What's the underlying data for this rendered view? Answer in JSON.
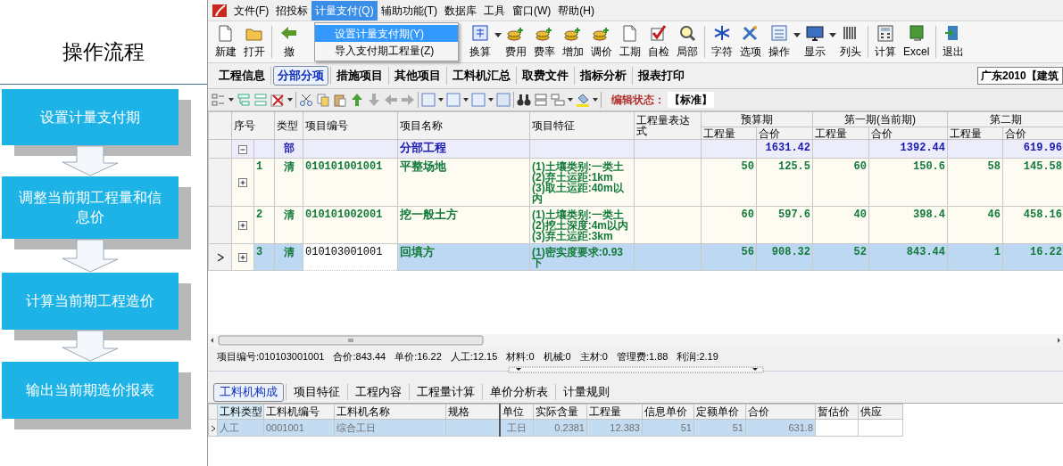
{
  "flow": {
    "title": "操作流程",
    "steps": [
      "设置计量支付期",
      "调整当前期工程量和信息价",
      "计算当前期工程造价",
      "输出当前期造价报表"
    ]
  },
  "menu": [
    {
      "label": "文件(F)",
      "selected": false
    },
    {
      "label": "招投标",
      "selected": false
    },
    {
      "label": "计量支付(Q)",
      "selected": true
    },
    {
      "label": "辅助功能(T)",
      "selected": false
    },
    {
      "label": "数据库",
      "selected": false
    },
    {
      "label": "工具",
      "selected": false
    },
    {
      "label": "窗口(W)",
      "selected": false
    },
    {
      "label": "帮助(H)",
      "selected": false
    }
  ],
  "dropdown": [
    {
      "label": "设置计量支付期(Y)",
      "selected": true
    },
    {
      "label": "导入支付期工程量(Z)",
      "selected": false
    }
  ],
  "toolbar": [
    {
      "label": "新建"
    },
    {
      "label": "打开",
      "separator_after": true
    },
    {
      "label": "撤",
      "hidden_gap": true
    },
    {
      "label": "换算",
      "dropdown": true
    },
    {
      "label": "费用"
    },
    {
      "label": "费率"
    },
    {
      "label": "增加"
    },
    {
      "label": "调价"
    },
    {
      "label": "工期"
    },
    {
      "label": "自检"
    },
    {
      "label": "局部",
      "separator_after": true
    },
    {
      "label": "字符"
    },
    {
      "label": "选项"
    },
    {
      "label": "操作",
      "dropdown": true
    },
    {
      "label": "显示",
      "dropdown": true
    },
    {
      "label": "列头",
      "separator_after": true
    },
    {
      "label": "计算"
    },
    {
      "label": "Excel",
      "separator_after": true
    },
    {
      "label": "退出"
    }
  ],
  "tabs": [
    {
      "label": "工程信息",
      "selected": false
    },
    {
      "label": "分部分项",
      "selected": true
    },
    {
      "label": "措施项目",
      "selected": false
    },
    {
      "label": "其他项目",
      "selected": false
    },
    {
      "label": "工料机汇总",
      "selected": false
    },
    {
      "label": "取费文件",
      "selected": false
    },
    {
      "label": "指标分析",
      "selected": false
    },
    {
      "label": "报表打印",
      "selected": false
    }
  ],
  "region_select": "广东2010【建筑",
  "edit_status": {
    "label": "编辑状态：",
    "value": "【标准】"
  },
  "grid": {
    "columns": [
      "序号",
      "类型",
      "项目编号",
      "项目名称",
      "项目特征",
      "工程量表达式"
    ],
    "periods": [
      {
        "label": "预算期",
        "sub_columns": [
          "工程量",
          "合价"
        ]
      },
      {
        "label": "第一期(当前期)",
        "sub_columns": [
          "工程量",
          "合价"
        ]
      },
      {
        "label": "第二期",
        "sub_columns": [
          "工程量",
          "合价"
        ]
      }
    ],
    "rows": [
      {
        "kind": "section",
        "expanded": true,
        "selected": false,
        "editing": false,
        "type": "部",
        "name": "分部工程",
        "budget_total": "1631.42",
        "p1_total": "1392.44",
        "p2_total": "619.96"
      },
      {
        "kind": "item",
        "expanded": false,
        "selected": false,
        "editing": false,
        "number": "1",
        "type": "清",
        "code": "010101001001",
        "name": "平整场地",
        "feature_lines": [
          "(1)土壤类别:一类土",
          "(2)弃土运距:1km",
          "(3)取土运距:40m以内"
        ],
        "budget_qty": "50",
        "budget_total": "125.5",
        "p1_qty": "60",
        "p1_total": "150.6",
        "p2_qty": "58",
        "p2_total": "145.58"
      },
      {
        "kind": "item",
        "expanded": false,
        "selected": false,
        "editing": false,
        "number": "2",
        "type": "清",
        "code": "010101002001",
        "name": "挖一般土方",
        "feature_lines": [
          "(1)土壤类别:一类土",
          "(2)挖土深度:4m以内",
          "(3)弃土运距:3km"
        ],
        "budget_qty": "60",
        "budget_total": "597.6",
        "p1_qty": "40",
        "p1_total": "398.4",
        "p2_qty": "46",
        "p2_total": "458.16"
      },
      {
        "kind": "item",
        "expanded": false,
        "selected": true,
        "editing": true,
        "number": "3",
        "type": "清",
        "code": "010103001001",
        "name": "回填方",
        "feature_lines": [
          "(1)密实度要求:0.93下"
        ],
        "budget_qty": "56",
        "budget_total": "908.32",
        "p1_qty": "52",
        "p1_total": "843.44",
        "p2_qty": "1",
        "p2_total": "16.22"
      }
    ]
  },
  "info_bar": [
    "项目编号:010103001001",
    "合价:843.44",
    "单价:16.22",
    "人工:12.15",
    "材料:0",
    "机械:0",
    "主材:0",
    "管理费:1.88",
    "利润:2.19"
  ],
  "detail_tabs": [
    {
      "label": "工料机构成",
      "selected": true
    },
    {
      "label": "项目特征",
      "selected": false
    },
    {
      "label": "工程内容",
      "selected": false
    },
    {
      "label": "工程量计算",
      "selected": false
    },
    {
      "label": "单价分析表",
      "selected": false
    },
    {
      "label": "计量规则",
      "selected": false
    }
  ],
  "detail_grid": {
    "columns": [
      "工料类型",
      "工料机编号",
      "工料机名称",
      "规格",
      "单位",
      "实际含量",
      "工程量",
      "信息单价",
      "定额单价",
      "合价",
      "暂估价",
      "供应"
    ],
    "rows": [
      {
        "selected": true,
        "cells": [
          "人工",
          "0001001",
          "综合工日",
          null,
          "工日",
          "0.2381",
          "12.383",
          "51",
          "51",
          "631.8",
          null,
          null
        ]
      }
    ]
  }
}
